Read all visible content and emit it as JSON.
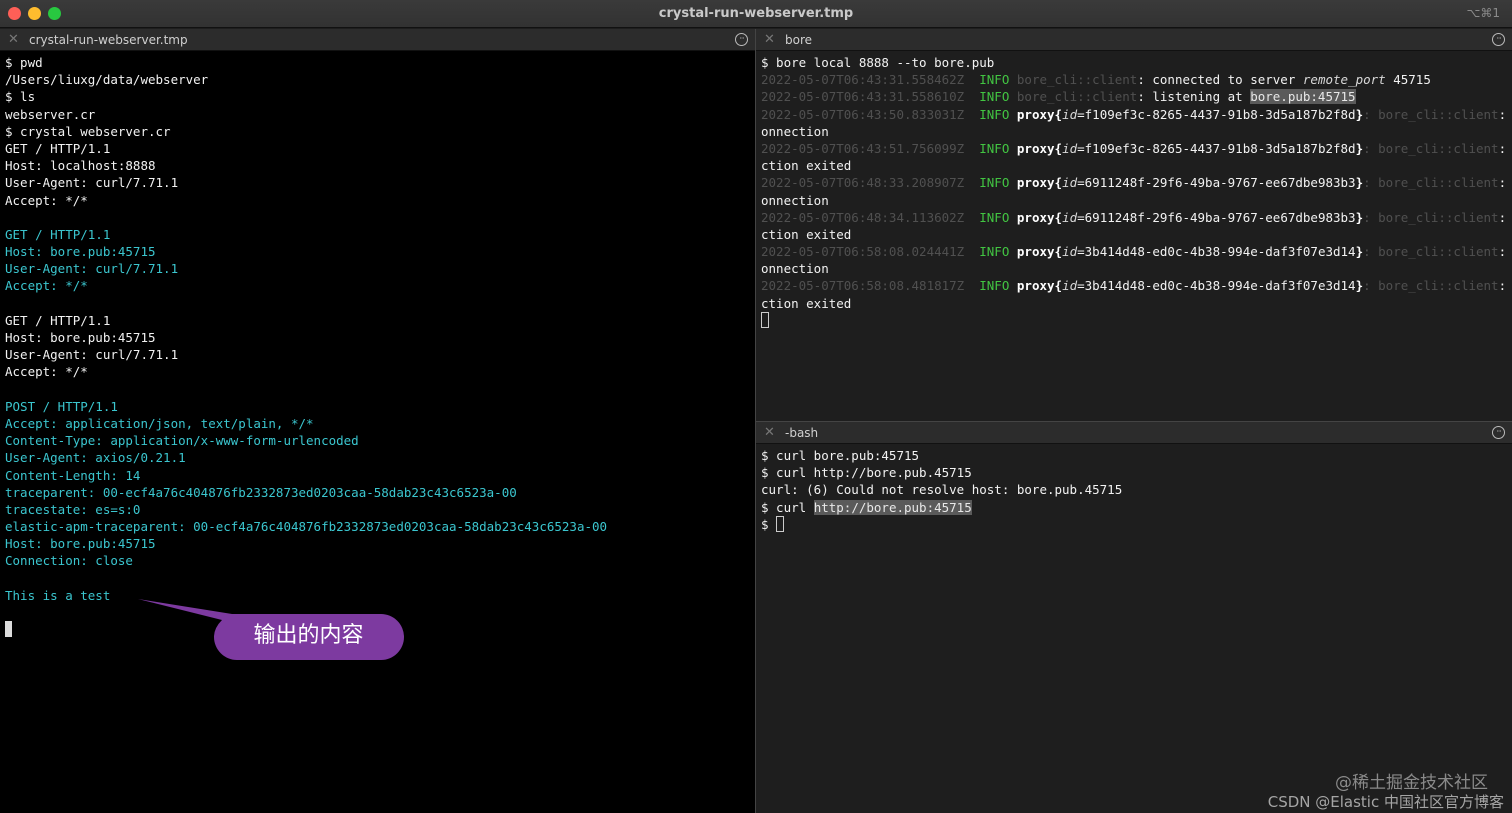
{
  "window": {
    "title": "crystal-run-webserver.tmp",
    "shortcut": "⌥⌘1"
  },
  "panes": {
    "left": {
      "tab": "crystal-run-webserver.tmp",
      "lines": [
        [
          {
            "t": "$ pwd",
            "c": "white"
          }
        ],
        [
          {
            "t": "/Users/liuxg/data/webserver",
            "c": "white"
          }
        ],
        [
          {
            "t": "$ ls",
            "c": "white"
          }
        ],
        [
          {
            "t": "webserver.cr",
            "c": "white"
          }
        ],
        [
          {
            "t": "$ crystal webserver.cr",
            "c": "white"
          }
        ],
        [
          {
            "t": "GET / HTTP/1.1",
            "c": "white"
          }
        ],
        [
          {
            "t": "Host: localhost:8888",
            "c": "white"
          }
        ],
        [
          {
            "t": "User-Agent: curl/7.71.1",
            "c": "white"
          }
        ],
        [
          {
            "t": "Accept: */*",
            "c": "white"
          }
        ],
        [],
        [
          {
            "t": "GET / HTTP/1.1",
            "c": "cyan"
          }
        ],
        [
          {
            "t": "Host: bore.pub:45715",
            "c": "cyan"
          }
        ],
        [
          {
            "t": "User-Agent: curl/7.71.1",
            "c": "cyan"
          }
        ],
        [
          {
            "t": "Accept: */*",
            "c": "cyan"
          }
        ],
        [],
        [
          {
            "t": "GET / HTTP/1.1",
            "c": "white"
          }
        ],
        [
          {
            "t": "Host: bore.pub:45715",
            "c": "white"
          }
        ],
        [
          {
            "t": "User-Agent: curl/7.71.1",
            "c": "white"
          }
        ],
        [
          {
            "t": "Accept: */*",
            "c": "white"
          }
        ],
        [],
        [
          {
            "t": "POST / HTTP/1.1",
            "c": "cyan"
          }
        ],
        [
          {
            "t": "Accept: application/json, text/plain, */*",
            "c": "cyan"
          }
        ],
        [
          {
            "t": "Content-Type: application/x-www-form-urlencoded",
            "c": "cyan"
          }
        ],
        [
          {
            "t": "User-Agent: axios/0.21.1",
            "c": "cyan"
          }
        ],
        [
          {
            "t": "Content-Length: 14",
            "c": "cyan"
          }
        ],
        [
          {
            "t": "traceparent: 00-ecf4a76c404876fb2332873ed0203caa-58dab23c43c6523a-00",
            "c": "cyan"
          }
        ],
        [
          {
            "t": "tracestate: es=s:0",
            "c": "cyan"
          }
        ],
        [
          {
            "t": "elastic-apm-traceparent: 00-ecf4a76c404876fb2332873ed0203caa-58dab23c43c6523a-00",
            "c": "cyan"
          }
        ],
        [
          {
            "t": "Host: bore.pub:45715",
            "c": "cyan"
          }
        ],
        [
          {
            "t": "Connection: close",
            "c": "cyan"
          }
        ],
        [],
        [
          {
            "t": "This is a test",
            "c": "cyan"
          }
        ],
        [],
        [
          {
            "cursor": "block"
          }
        ]
      ]
    },
    "bore": {
      "tab": "bore",
      "lines": [
        [
          {
            "t": "$ bore local 8888 --to bore.pub",
            "c": "white"
          }
        ],
        [
          {
            "t": "2022-05-07T06:43:31.558462Z",
            "c": "dim"
          },
          {
            "t": "  INFO ",
            "c": "green"
          },
          {
            "t": "bore_cli::client",
            "c": "dim"
          },
          {
            "t": ": connected to server ",
            "c": "white"
          },
          {
            "t": "remote_port",
            "c": "it"
          },
          {
            "t": " 45715",
            "c": "white"
          }
        ],
        [
          {
            "t": "2022-05-07T06:43:31.558610Z",
            "c": "dim"
          },
          {
            "t": "  INFO ",
            "c": "green"
          },
          {
            "t": "bore_cli::client",
            "c": "dim"
          },
          {
            "t": ": listening at ",
            "c": "white"
          },
          {
            "t": "bore.pub:45715",
            "c": "hl"
          }
        ],
        [
          {
            "t": "2022-05-07T06:43:50.833031Z",
            "c": "dim"
          },
          {
            "t": "  INFO ",
            "c": "green"
          },
          {
            "t": "proxy",
            "c": "bold"
          },
          {
            "t": "{",
            "c": "bold"
          },
          {
            "t": "id",
            "c": "it"
          },
          {
            "t": "=f109ef3c-8265-4437-91b8-3d5a187b2f8d",
            "c": "white"
          },
          {
            "t": "}",
            "c": "bold"
          },
          {
            "t": ": bore_cli::client",
            "c": "dim"
          },
          {
            "t": ": new c",
            "c": "white"
          }
        ],
        [
          {
            "t": "onnection",
            "c": "white"
          }
        ],
        [
          {
            "t": "2022-05-07T06:43:51.756099Z",
            "c": "dim"
          },
          {
            "t": "  INFO ",
            "c": "green"
          },
          {
            "t": "proxy",
            "c": "bold"
          },
          {
            "t": "{",
            "c": "bold"
          },
          {
            "t": "id",
            "c": "it"
          },
          {
            "t": "=f109ef3c-8265-4437-91b8-3d5a187b2f8d",
            "c": "white"
          },
          {
            "t": "}",
            "c": "bold"
          },
          {
            "t": ": bore_cli::client",
            "c": "dim"
          },
          {
            "t": ": conne",
            "c": "white"
          }
        ],
        [
          {
            "t": "ction exited",
            "c": "white"
          }
        ],
        [
          {
            "t": "2022-05-07T06:48:33.208907Z",
            "c": "dim"
          },
          {
            "t": "  INFO ",
            "c": "green"
          },
          {
            "t": "proxy",
            "c": "bold"
          },
          {
            "t": "{",
            "c": "bold"
          },
          {
            "t": "id",
            "c": "it"
          },
          {
            "t": "=6911248f-29f6-49ba-9767-ee67dbe983b3",
            "c": "white"
          },
          {
            "t": "}",
            "c": "bold"
          },
          {
            "t": ": bore_cli::client",
            "c": "dim"
          },
          {
            "t": ": new c",
            "c": "white"
          }
        ],
        [
          {
            "t": "onnection",
            "c": "white"
          }
        ],
        [
          {
            "t": "2022-05-07T06:48:34.113602Z",
            "c": "dim"
          },
          {
            "t": "  INFO ",
            "c": "green"
          },
          {
            "t": "proxy",
            "c": "bold"
          },
          {
            "t": "{",
            "c": "bold"
          },
          {
            "t": "id",
            "c": "it"
          },
          {
            "t": "=6911248f-29f6-49ba-9767-ee67dbe983b3",
            "c": "white"
          },
          {
            "t": "}",
            "c": "bold"
          },
          {
            "t": ": bore_cli::client",
            "c": "dim"
          },
          {
            "t": ": conne",
            "c": "white"
          }
        ],
        [
          {
            "t": "ction exited",
            "c": "white"
          }
        ],
        [
          {
            "t": "2022-05-07T06:58:08.024441Z",
            "c": "dim"
          },
          {
            "t": "  INFO ",
            "c": "green"
          },
          {
            "t": "proxy",
            "c": "bold"
          },
          {
            "t": "{",
            "c": "bold"
          },
          {
            "t": "id",
            "c": "it"
          },
          {
            "t": "=3b414d48-ed0c-4b38-994e-daf3f07e3d14",
            "c": "white"
          },
          {
            "t": "}",
            "c": "bold"
          },
          {
            "t": ": bore_cli::client",
            "c": "dim"
          },
          {
            "t": ": new c",
            "c": "white"
          }
        ],
        [
          {
            "t": "onnection",
            "c": "white"
          }
        ],
        [
          {
            "t": "2022-05-07T06:58:08.481817Z",
            "c": "dim"
          },
          {
            "t": "  INFO ",
            "c": "green"
          },
          {
            "t": "proxy",
            "c": "bold"
          },
          {
            "t": "{",
            "c": "bold"
          },
          {
            "t": "id",
            "c": "it"
          },
          {
            "t": "=3b414d48-ed0c-4b38-994e-daf3f07e3d14",
            "c": "white"
          },
          {
            "t": "}",
            "c": "bold"
          },
          {
            "t": ": bore_cli::client",
            "c": "dim"
          },
          {
            "t": ": conne",
            "c": "white"
          }
        ],
        [
          {
            "t": "ction exited",
            "c": "white"
          }
        ],
        [
          {
            "cursor": "outline"
          }
        ]
      ]
    },
    "bash": {
      "tab": "-bash",
      "lines": [
        [
          {
            "t": "$ curl bore.pub:45715",
            "c": "white"
          }
        ],
        [
          {
            "t": "$ curl http://bore.pub.45715",
            "c": "white"
          }
        ],
        [
          {
            "t": "curl: (6) Could not resolve host: bore.pub.45715",
            "c": "white"
          }
        ],
        [
          {
            "t": "$ curl ",
            "c": "white"
          },
          {
            "t": "http://bore.pub:45715",
            "c": "hl"
          }
        ],
        [
          {
            "t": "$ ",
            "c": "white"
          },
          {
            "cursor": "outline"
          }
        ]
      ]
    }
  },
  "callout": {
    "text": "输出的内容",
    "color": "#7d3aa0"
  },
  "watermarks": {
    "line1": "@稀土掘金技术社区",
    "line2": "CSDN @Elastic 中国社区官方博客"
  }
}
